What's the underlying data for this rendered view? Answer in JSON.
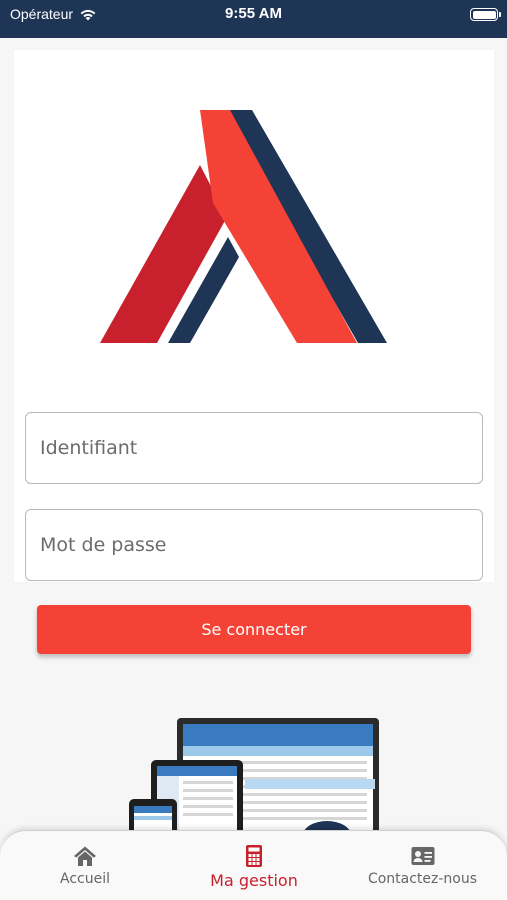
{
  "status_bar": {
    "carrier": "Opérateur",
    "time": "9:55 AM"
  },
  "login": {
    "username_placeholder": "Identifiant",
    "password_placeholder": "Mot de passe",
    "submit_label": "Se connecter"
  },
  "tabbar": {
    "items": [
      {
        "label": "Accueil",
        "icon": "home-icon",
        "active": false
      },
      {
        "label": "Ma gestion",
        "icon": "calculator-icon",
        "active": true
      },
      {
        "label": "Contactez-nous",
        "icon": "contact-card-icon",
        "active": false
      }
    ]
  },
  "colors": {
    "status_bar": "#1f3556",
    "brand_red": "#f44336",
    "brand_navy": "#1f3556",
    "active_tab": "#c8202c"
  }
}
